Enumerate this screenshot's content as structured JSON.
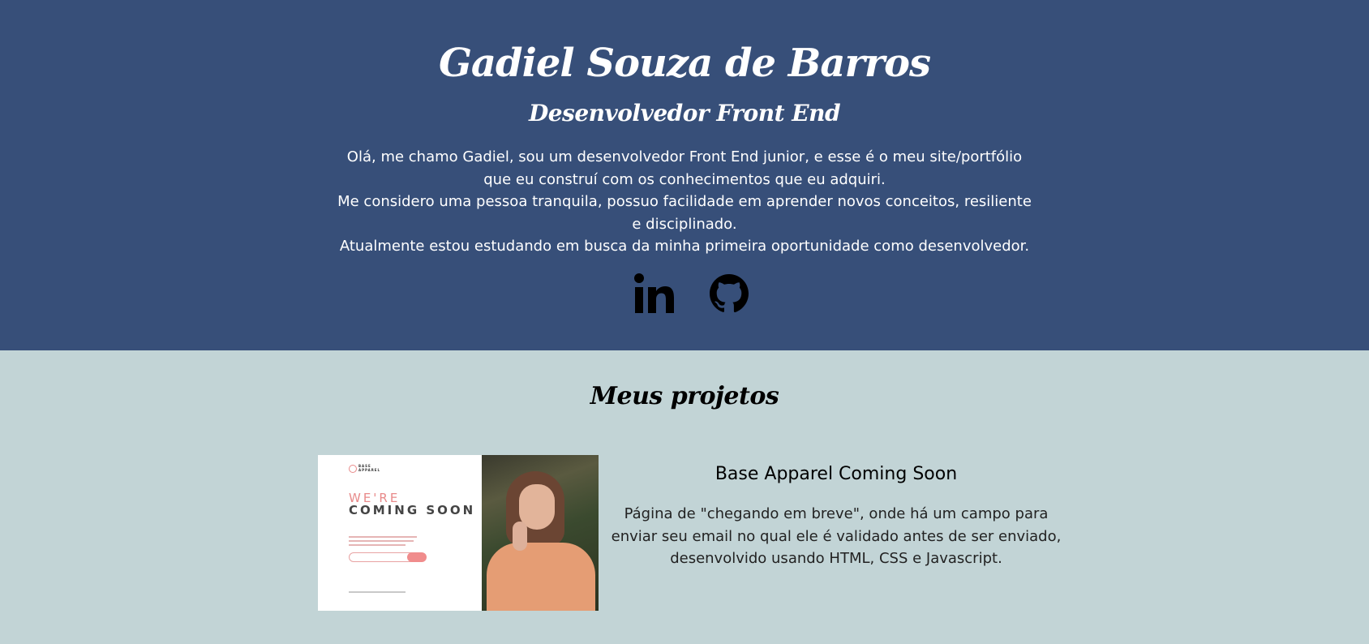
{
  "header": {
    "name": "Gadiel Souza de Barros",
    "role": "Desenvolvedor Front End",
    "bio_lines": [
      "Olá, me chamo Gadiel, sou um desenvolvedor Front End junior, e esse é o meu site/portfólio que eu construí com os conhecimentos que eu adquiri.",
      "Me considero uma pessoa tranquila, possuo facilidade em aprender novos conceitos, resiliente e disciplinado.",
      "Atualmente estou estudando em busca da minha primeira oportunidade como desenvolvedor."
    ],
    "socials": [
      {
        "name": "LinkedIn",
        "icon": "linkedin-icon"
      },
      {
        "name": "GitHub",
        "icon": "github-icon"
      }
    ]
  },
  "projects": {
    "heading": "Meus projetos",
    "items": [
      {
        "title": "Base Apparel Coming Soon",
        "description": "Página de \"chegando em breve\", onde há um campo para enviar seu email no qual ele é validado antes de ser enviado, desenvolvido usando HTML, CSS e Javascript.",
        "thumbnail": {
          "logo_text": "BASE APPAREL",
          "headline_top": "WE'RE",
          "headline_bottom": "COMING SOON"
        }
      }
    ]
  },
  "colors": {
    "hero_background": "#374f79",
    "projects_background": "#c2d4d6",
    "accent_pink": "#f08c8c"
  }
}
